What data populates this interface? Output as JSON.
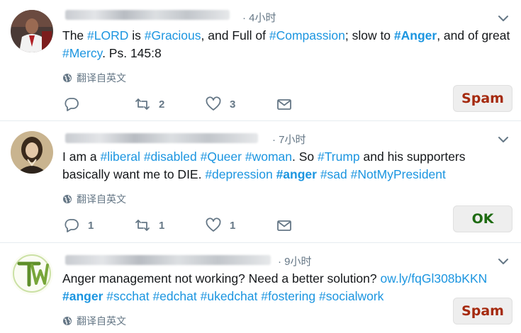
{
  "tweets": [
    {
      "time": "· 4小时",
      "line1": [
        {
          "t": "The ",
          "tag": false
        },
        {
          "t": "#LORD",
          "tag": true
        },
        {
          "t": " is ",
          "tag": false
        },
        {
          "t": "#Gracious",
          "tag": true
        },
        {
          "t": ", and Full of ",
          "tag": false
        },
        {
          "t": "#Compassion",
          "tag": true
        },
        {
          "t": "; slow to ",
          "tag": false
        },
        {
          "t": "#Anger",
          "tag": true,
          "bold": true
        },
        {
          "t": ", and of great",
          "tag": false
        }
      ],
      "line2": [
        {
          "t": "#Mercy",
          "tag": true
        },
        {
          "t": ". Ps. 145:8",
          "tag": false
        }
      ],
      "translate": "翻译自英文",
      "reply_count": "",
      "retweet_count": "2",
      "like_count": "3",
      "label": "Spam",
      "label_color": "#a52a0f"
    },
    {
      "time": "· 7小时",
      "line1": [
        {
          "t": "I am a ",
          "tag": false
        },
        {
          "t": "#liberal",
          "tag": true
        },
        {
          "t": " ",
          "tag": false
        },
        {
          "t": "#disabled",
          "tag": true
        },
        {
          "t": " ",
          "tag": false
        },
        {
          "t": "#Queer",
          "tag": true
        },
        {
          "t": " ",
          "tag": false
        },
        {
          "t": "#woman",
          "tag": true
        },
        {
          "t": ". So ",
          "tag": false
        },
        {
          "t": "#Trump",
          "tag": true
        },
        {
          "t": " and his supporters",
          "tag": false
        }
      ],
      "line2": [
        {
          "t": "basically want me to DIE.  ",
          "tag": false
        },
        {
          "t": "#depression",
          "tag": true
        },
        {
          "t": " ",
          "tag": false
        },
        {
          "t": "#anger",
          "tag": true,
          "bold": true
        },
        {
          "t": " ",
          "tag": false
        },
        {
          "t": "#sad",
          "tag": true
        },
        {
          "t": " ",
          "tag": false
        },
        {
          "t": "#NotMyPresident",
          "tag": true
        }
      ],
      "translate": "翻译自英文",
      "reply_count": "1",
      "retweet_count": "1",
      "like_count": "1",
      "label": "OK",
      "label_color": "#1e6b12"
    },
    {
      "time": "· 9小时",
      "line1": [
        {
          "t": "Anger management not working? Need a better solution? ",
          "tag": false
        },
        {
          "t": "ow.ly/fqGl308bKKN",
          "tag": true
        }
      ],
      "line2": [
        {
          "t": "#anger",
          "tag": true,
          "bold": true
        },
        {
          "t": " ",
          "tag": false
        },
        {
          "t": "#scchat",
          "tag": true
        },
        {
          "t": " ",
          "tag": false
        },
        {
          "t": "#edchat",
          "tag": true
        },
        {
          "t": " ",
          "tag": false
        },
        {
          "t": "#ukedchat",
          "tag": true
        },
        {
          "t": " ",
          "tag": false
        },
        {
          "t": "#fostering",
          "tag": true
        },
        {
          "t": " ",
          "tag": false
        },
        {
          "t": "#socialwork",
          "tag": true
        }
      ],
      "translate": "翻译自英文",
      "label": "Spam",
      "label_color": "#a52a0f"
    }
  ],
  "icons": {
    "reply": "reply-icon",
    "retweet": "retweet-icon",
    "like": "heart-icon",
    "dm": "envelope-icon",
    "globe": "globe-icon",
    "caret": "chevron-down-icon"
  },
  "colors": {
    "hashtag": "#1b95e0",
    "muted": "#657786"
  }
}
